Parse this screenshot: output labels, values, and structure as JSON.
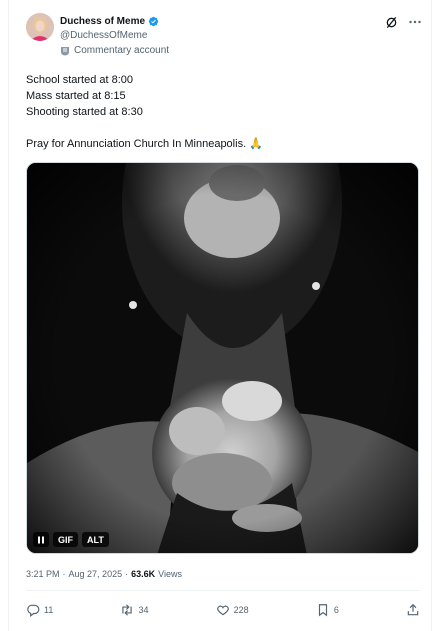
{
  "author": {
    "display_name": "Duchess of Meme",
    "handle": "@DuchessOfMeme",
    "affiliation": "Commentary account"
  },
  "post": {
    "lines": [
      "School started at 8:00",
      "Mass started at 8:15",
      "Shooting started at 8:30",
      "",
      "Pray for Annunciation Church In Minneapolis. 🙏"
    ]
  },
  "media": {
    "controls": {
      "gif": "GIF",
      "alt": "ALT"
    }
  },
  "meta": {
    "time": "3:21 PM",
    "separator1": "·",
    "date": "Aug 27, 2025",
    "separator2": "·",
    "views_count": "63.6K",
    "views_label": "Views"
  },
  "actions": {
    "replies": "11",
    "reposts": "34",
    "likes": "228",
    "bookmarks": "6"
  },
  "colors": {
    "verified": "#1d9bf0",
    "text": "#0f1419",
    "secondary": "#536471"
  },
  "icons": [
    "verified-icon",
    "grok-icon",
    "more-icon",
    "commentary-badge-icon",
    "pause-icon",
    "reply-icon",
    "repost-icon",
    "like-icon",
    "bookmark-icon",
    "share-icon"
  ]
}
